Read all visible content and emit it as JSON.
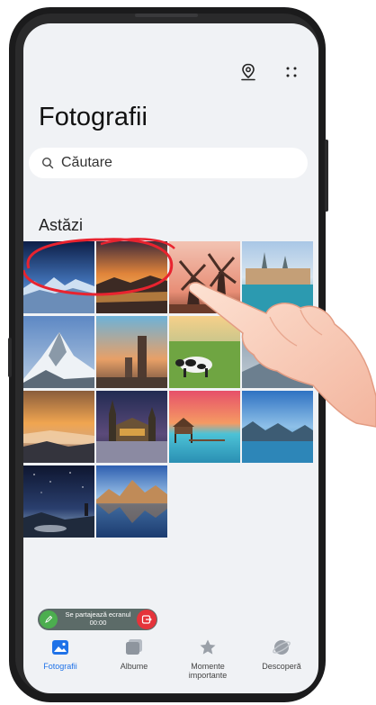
{
  "app": {
    "title": "Fotografii"
  },
  "header": {
    "icons": [
      "map-pin-icon",
      "more-icon"
    ]
  },
  "search": {
    "placeholder": "Căutare"
  },
  "section": {
    "label": "Astăzi"
  },
  "photos": [
    "blue-mountains-night",
    "orange-sunset-lake",
    "windmills",
    "city-by-river",
    "snowy-peak",
    "stone-tower",
    "cow-in-field",
    "sunset-fog",
    "church-at-dusk",
    "water-bungalows",
    "turquoise-lake",
    "starry-shore",
    "lake-reflection"
  ],
  "screen_share": {
    "label": "Se partajează ecranul",
    "time": "00:00"
  },
  "tabs": [
    {
      "label": "Fotografii",
      "icon": "photo-icon",
      "active": true
    },
    {
      "label": "Albume",
      "icon": "album-icon",
      "active": false
    },
    {
      "label": "Momente importante",
      "icon": "star-icon",
      "active": false
    },
    {
      "label": "Descoperă",
      "icon": "planet-icon",
      "active": false
    }
  ],
  "colors": {
    "accent": "#1f72e8",
    "background": "#f0f2f5",
    "annotation_red": "#e8232f"
  }
}
